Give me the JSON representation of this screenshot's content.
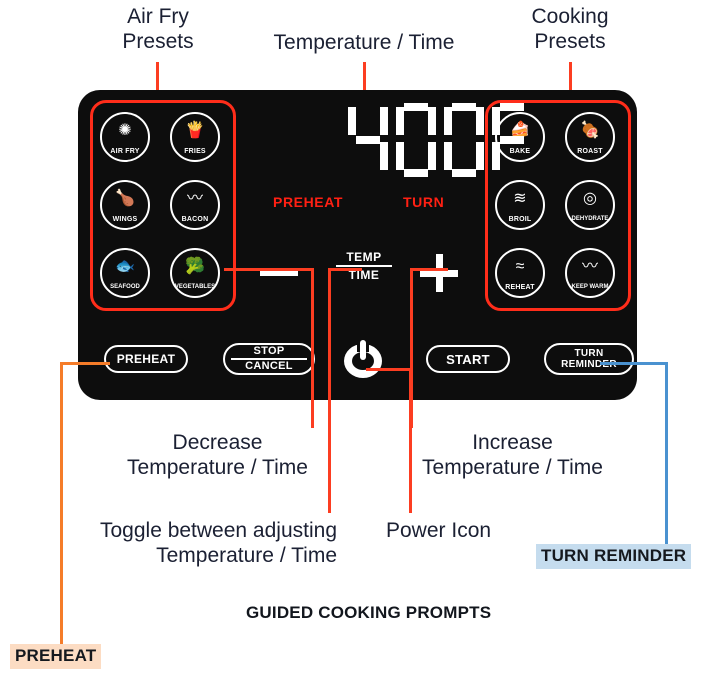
{
  "diagram": {
    "title_note": "GUIDED COOKING PROMPTS",
    "top_labels": {
      "air_fry": "Air Fry\nPresets",
      "temp_time": "Temperature / Time",
      "cooking": "Cooking\nPresets"
    },
    "bottom_labels": {
      "decrease": "Decrease\nTemperature / Time",
      "increase": "Increase\nTemperature / Time",
      "toggle": "Toggle between adjusting\nTemperature / Time",
      "power": "Power Icon"
    },
    "chips": {
      "preheat": "PREHEAT",
      "turn_reminder": "TURN REMINDER"
    },
    "colors": {
      "callout_red": "#fc3d21",
      "callout_orange": "#f57c29",
      "callout_blue": "#4a92d0",
      "group_outline": "#ff2d1a",
      "panel_bg": "#0d0d0d",
      "display_white": "#ffffff",
      "indicator_red": "#ff2013",
      "chip_preheat_bg": "#fcdcc3",
      "chip_turn_bg": "#c5dcee"
    }
  },
  "panel": {
    "display": {
      "value": "400F",
      "digits": [
        "4",
        "0",
        "0",
        "F"
      ],
      "indicators": [
        {
          "name": "preheat-indicator",
          "label": "PREHEAT"
        },
        {
          "name": "turn-indicator",
          "label": "TURN"
        }
      ]
    },
    "air_fry_presets": [
      {
        "label": "AIR FRY",
        "glyph": "✺"
      },
      {
        "label": "FRIES",
        "glyph": "🍟"
      },
      {
        "label": "WINGS",
        "glyph": "🍗"
      },
      {
        "label": "BACON",
        "glyph": "〰"
      },
      {
        "label": "SEAFOOD",
        "glyph": "🐟"
      },
      {
        "label": "VEGETABLES",
        "glyph": "🥦"
      }
    ],
    "cooking_presets": [
      {
        "label": "BAKE",
        "glyph": "🥐"
      },
      {
        "label": "ROAST",
        "glyph": "🍖"
      },
      {
        "label": "BROIL",
        "glyph": "≋"
      },
      {
        "label": "DEHYDRATE",
        "glyph": "◎"
      },
      {
        "label": "REHEAT",
        "glyph": "≈"
      },
      {
        "label": "KEEP WARM",
        "glyph": "〜"
      }
    ],
    "controls": {
      "minus": "—",
      "plus": "+",
      "temp": "TEMP",
      "time": "TIME"
    },
    "buttons": [
      {
        "name": "preheat-button",
        "line1": "PREHEAT",
        "line2": ""
      },
      {
        "name": "stop-cancel-button",
        "line1": "STOP",
        "line2": "CANCEL"
      },
      {
        "name": "start-button",
        "line1": "START",
        "line2": ""
      },
      {
        "name": "turn-reminder-button",
        "line1": "TURN",
        "line2": "REMINDER"
      }
    ],
    "power_button": {
      "name": "power-button",
      "label": "Power"
    }
  }
}
